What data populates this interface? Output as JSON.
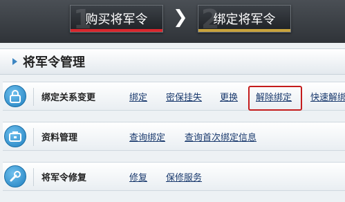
{
  "steps": [
    {
      "num": "1",
      "label": "购买将军令",
      "accent": "#d9262c"
    },
    {
      "num": "2",
      "label": "绑定将军令",
      "accent": "#c9a33b"
    }
  ],
  "arrow": "❯",
  "section": {
    "title": "将军令管理"
  },
  "rows": [
    {
      "icon": "lock-icon",
      "label": "绑定关系变更",
      "links": [
        "绑定",
        "密保挂失",
        "更换",
        "解除绑定",
        "快速解绑"
      ]
    },
    {
      "icon": "briefcase-icon",
      "label": "资料管理",
      "links": [
        "查询绑定",
        "查询首次绑定信息"
      ]
    },
    {
      "icon": "repair-icon",
      "label": "将军令修复",
      "links": [
        "修复",
        "保修服务"
      ]
    }
  ],
  "highlight_color": "#c41c1c"
}
